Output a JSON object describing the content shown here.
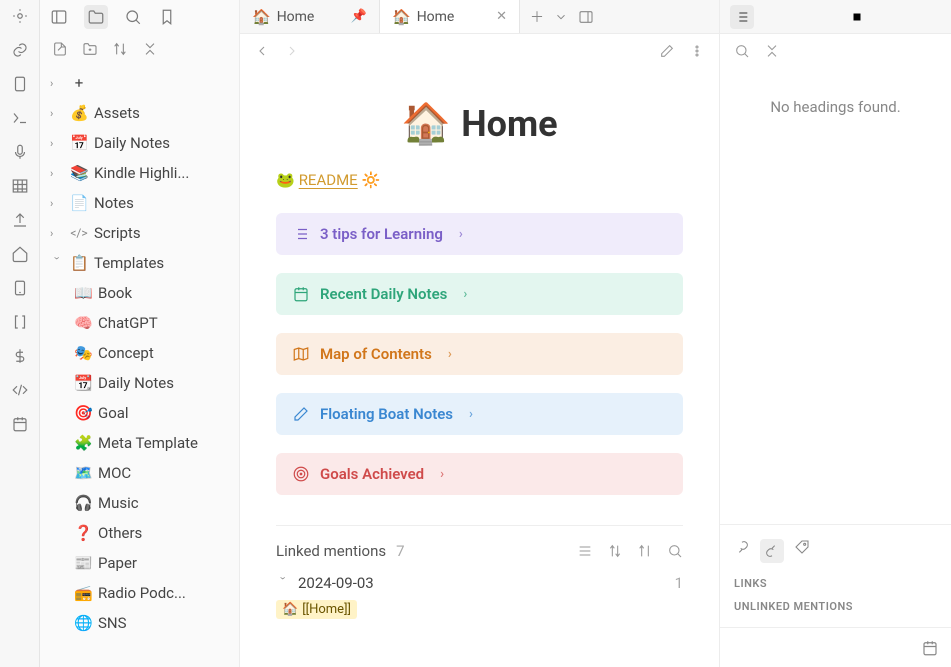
{
  "tabs": [
    {
      "icon": "🏠",
      "label": "Home",
      "pinned": true
    },
    {
      "icon": "🏠",
      "label": "Home",
      "active": true
    }
  ],
  "page": {
    "icon": "🏠",
    "title": "Home"
  },
  "readme": {
    "prefix_emoji": "🐸",
    "link_text": "README",
    "suffix_emoji": "🔆"
  },
  "callouts": [
    {
      "style": "c-purple",
      "icon": "list",
      "label": "3 tips for Learning"
    },
    {
      "style": "c-green",
      "icon": "calendar",
      "label": "Recent Daily Notes"
    },
    {
      "style": "c-orange",
      "icon": "map",
      "label": "Map of Contents"
    },
    {
      "style": "c-blue",
      "icon": "pencil",
      "label": "Floating Boat Notes"
    },
    {
      "style": "c-red",
      "icon": "target",
      "label": "Goals Achieved"
    }
  ],
  "linked": {
    "heading": "Linked mentions",
    "count": "7",
    "date": "2024-09-03",
    "date_count": "1",
    "chip_icon": "🏠",
    "chip_text": "[[Home]]"
  },
  "sidebar": {
    "folders": [
      {
        "icon": "+",
        "label": ""
      },
      {
        "icon": "💰",
        "label": "Assets"
      },
      {
        "icon": "📅",
        "label": "Daily Notes"
      },
      {
        "icon": "📚",
        "label": "Kindle Highli..."
      },
      {
        "icon": "📄",
        "label": "Notes"
      },
      {
        "icon": "</>",
        "label": "Scripts"
      }
    ],
    "templates_label": "Templates",
    "templates_icon": "📋",
    "templates": [
      {
        "icon": "📖",
        "label": "Book"
      },
      {
        "icon": "🧠",
        "label": "ChatGPT"
      },
      {
        "icon": "🎭",
        "label": "Concept"
      },
      {
        "icon": "📆",
        "label": "Daily Notes"
      },
      {
        "icon": "🎯",
        "label": "Goal"
      },
      {
        "icon": "🧩",
        "label": "Meta Template"
      },
      {
        "icon": "🗺️",
        "label": "MOC"
      },
      {
        "icon": "🎧",
        "label": "Music"
      },
      {
        "icon": "❓",
        "label": "Others"
      },
      {
        "icon": "📰",
        "label": "Paper"
      },
      {
        "icon": "📻",
        "label": "Radio Podc..."
      },
      {
        "icon": "🌐",
        "label": "SNS"
      }
    ]
  },
  "rightpanel": {
    "empty_text": "No headings found.",
    "section1": "LINKS",
    "section2": "UNLINKED MENTIONS"
  }
}
